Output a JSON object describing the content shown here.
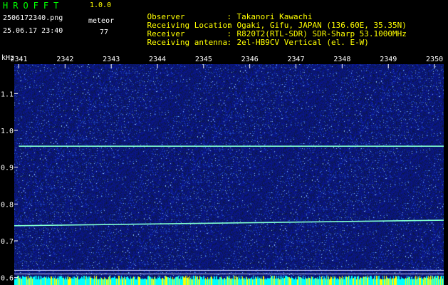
{
  "app": {
    "title": "HROFFT",
    "version": "1.0.0",
    "file_name": "2506172340.png",
    "datetime": "25.06.17 23:40",
    "event_label": "meteor",
    "event_count": "77"
  },
  "info": [
    {
      "label": "Observer",
      "value": "Takanori Kawachi"
    },
    {
      "label": "Receiving Location",
      "value": "Ogaki, Gifu, JAPAN (136.60E, 35.35N)"
    },
    {
      "label": "Receiver",
      "value": "R820T2(RTL-SDR) SDR-Sharp 53.1000MHz"
    },
    {
      "label": "Receiving antenna",
      "value": "2el-HB9CV Vertical (el. E-W)"
    }
  ],
  "colors": {
    "background": "#000000",
    "spectrum_blue": "#0a1a80",
    "carrier_line": "#80ffd0",
    "axis_text": "#ffffff",
    "header_green": "#00ff00",
    "header_yellow": "#ffff00",
    "bottom_bar": "#00ffff"
  },
  "chart_data": {
    "type": "heatmap",
    "ylabel": "kHz",
    "x_ticks": [
      "2341",
      "2342",
      "2343",
      "2344",
      "2345",
      "2346",
      "2347",
      "2348",
      "2349",
      "2350"
    ],
    "y_ticks": [
      "1.1",
      "1.0",
      "0.9",
      "0.8",
      "0.7",
      "0.6"
    ],
    "x_range": [
      2340.9,
      2350.2
    ],
    "y_range": [
      0.58,
      1.18
    ],
    "lines": [
      {
        "name": "",
        "x_start": 2341,
        "x_end": 2350.2,
        "y_start": 0.957,
        "y_end": 0.957
      },
      {
        "name": "",
        "x_start": 2340.9,
        "x_end": 2350.2,
        "y_start": 0.741,
        "y_end": 0.756
      }
    ],
    "reference_lines_khz": [
      0.62,
      0.61
    ]
  }
}
